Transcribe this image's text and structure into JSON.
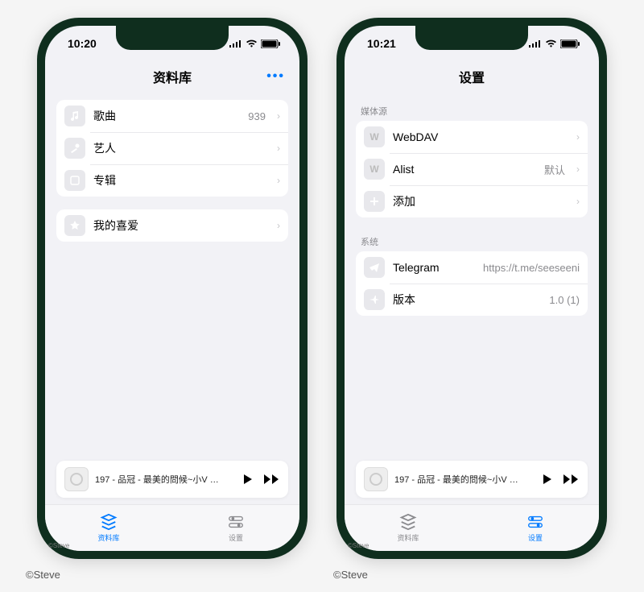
{
  "credit": "©Steve",
  "phone_left": {
    "status": {
      "time": "10:20"
    },
    "nav": {
      "title": "资料库",
      "more_label": "•••"
    },
    "library_rows": [
      {
        "icon": "music-note-icon",
        "label": "歌曲",
        "detail": "939"
      },
      {
        "icon": "microphone-icon",
        "label": "艺人",
        "detail": ""
      },
      {
        "icon": "album-icon",
        "label": "专辑",
        "detail": ""
      }
    ],
    "favorites_rows": [
      {
        "icon": "star-icon",
        "label": "我的喜爱",
        "detail": ""
      }
    ],
    "now_playing": {
      "title": "197 - 品冠 - 最美的問候~小V …"
    },
    "tabs": {
      "library": "资料库",
      "settings": "设置",
      "active": "library"
    }
  },
  "phone_right": {
    "status": {
      "time": "10:21"
    },
    "nav": {
      "title": "设置"
    },
    "section_media": {
      "header": "媒体源",
      "rows": [
        {
          "icon": "w-icon",
          "label": "WebDAV",
          "detail": ""
        },
        {
          "icon": "w-icon",
          "label": "Alist",
          "detail": "默认"
        },
        {
          "icon": "plus-icon",
          "label": "添加",
          "detail": ""
        }
      ]
    },
    "section_system": {
      "header": "系统",
      "rows": [
        {
          "icon": "telegram-icon",
          "label": "Telegram",
          "detail": "https://t.me/seeseeni"
        },
        {
          "icon": "plane-icon",
          "label": "版本",
          "detail": "1.0 (1)"
        }
      ]
    },
    "now_playing": {
      "title": "197 - 品冠 - 最美的問候~小V …"
    },
    "tabs": {
      "library": "资料库",
      "settings": "设置",
      "active": "settings"
    }
  }
}
